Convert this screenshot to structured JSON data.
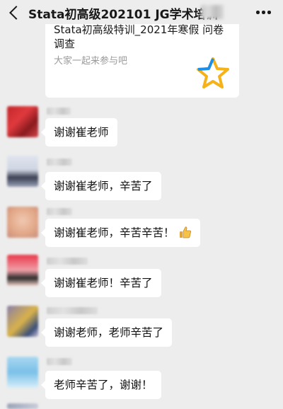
{
  "header": {
    "title": "Stata初高级202101 JG学术培训",
    "back_icon": "back-chevron-icon",
    "more_icon": "more-dots-icon"
  },
  "card": {
    "title": "Stata初高级特训_2021年寒假 问卷调查",
    "subtitle": "大家一起来参与吧",
    "icon": "star-icon",
    "colors": {
      "star_gold": "#f5b219",
      "star_blue": "#1d8fe8"
    }
  },
  "messages": [
    {
      "text": "谢谢崔老师"
    },
    {
      "text": "谢谢崔老师，辛苦了"
    },
    {
      "text": "谢谢崔老师，辛苦辛苦！",
      "emoji": "thumbs-up-icon"
    },
    {
      "text": "谢谢崔老师！辛苦了"
    },
    {
      "text": "谢谢老师，老师辛苦了"
    },
    {
      "text": "老师辛苦了，谢谢！"
    }
  ]
}
